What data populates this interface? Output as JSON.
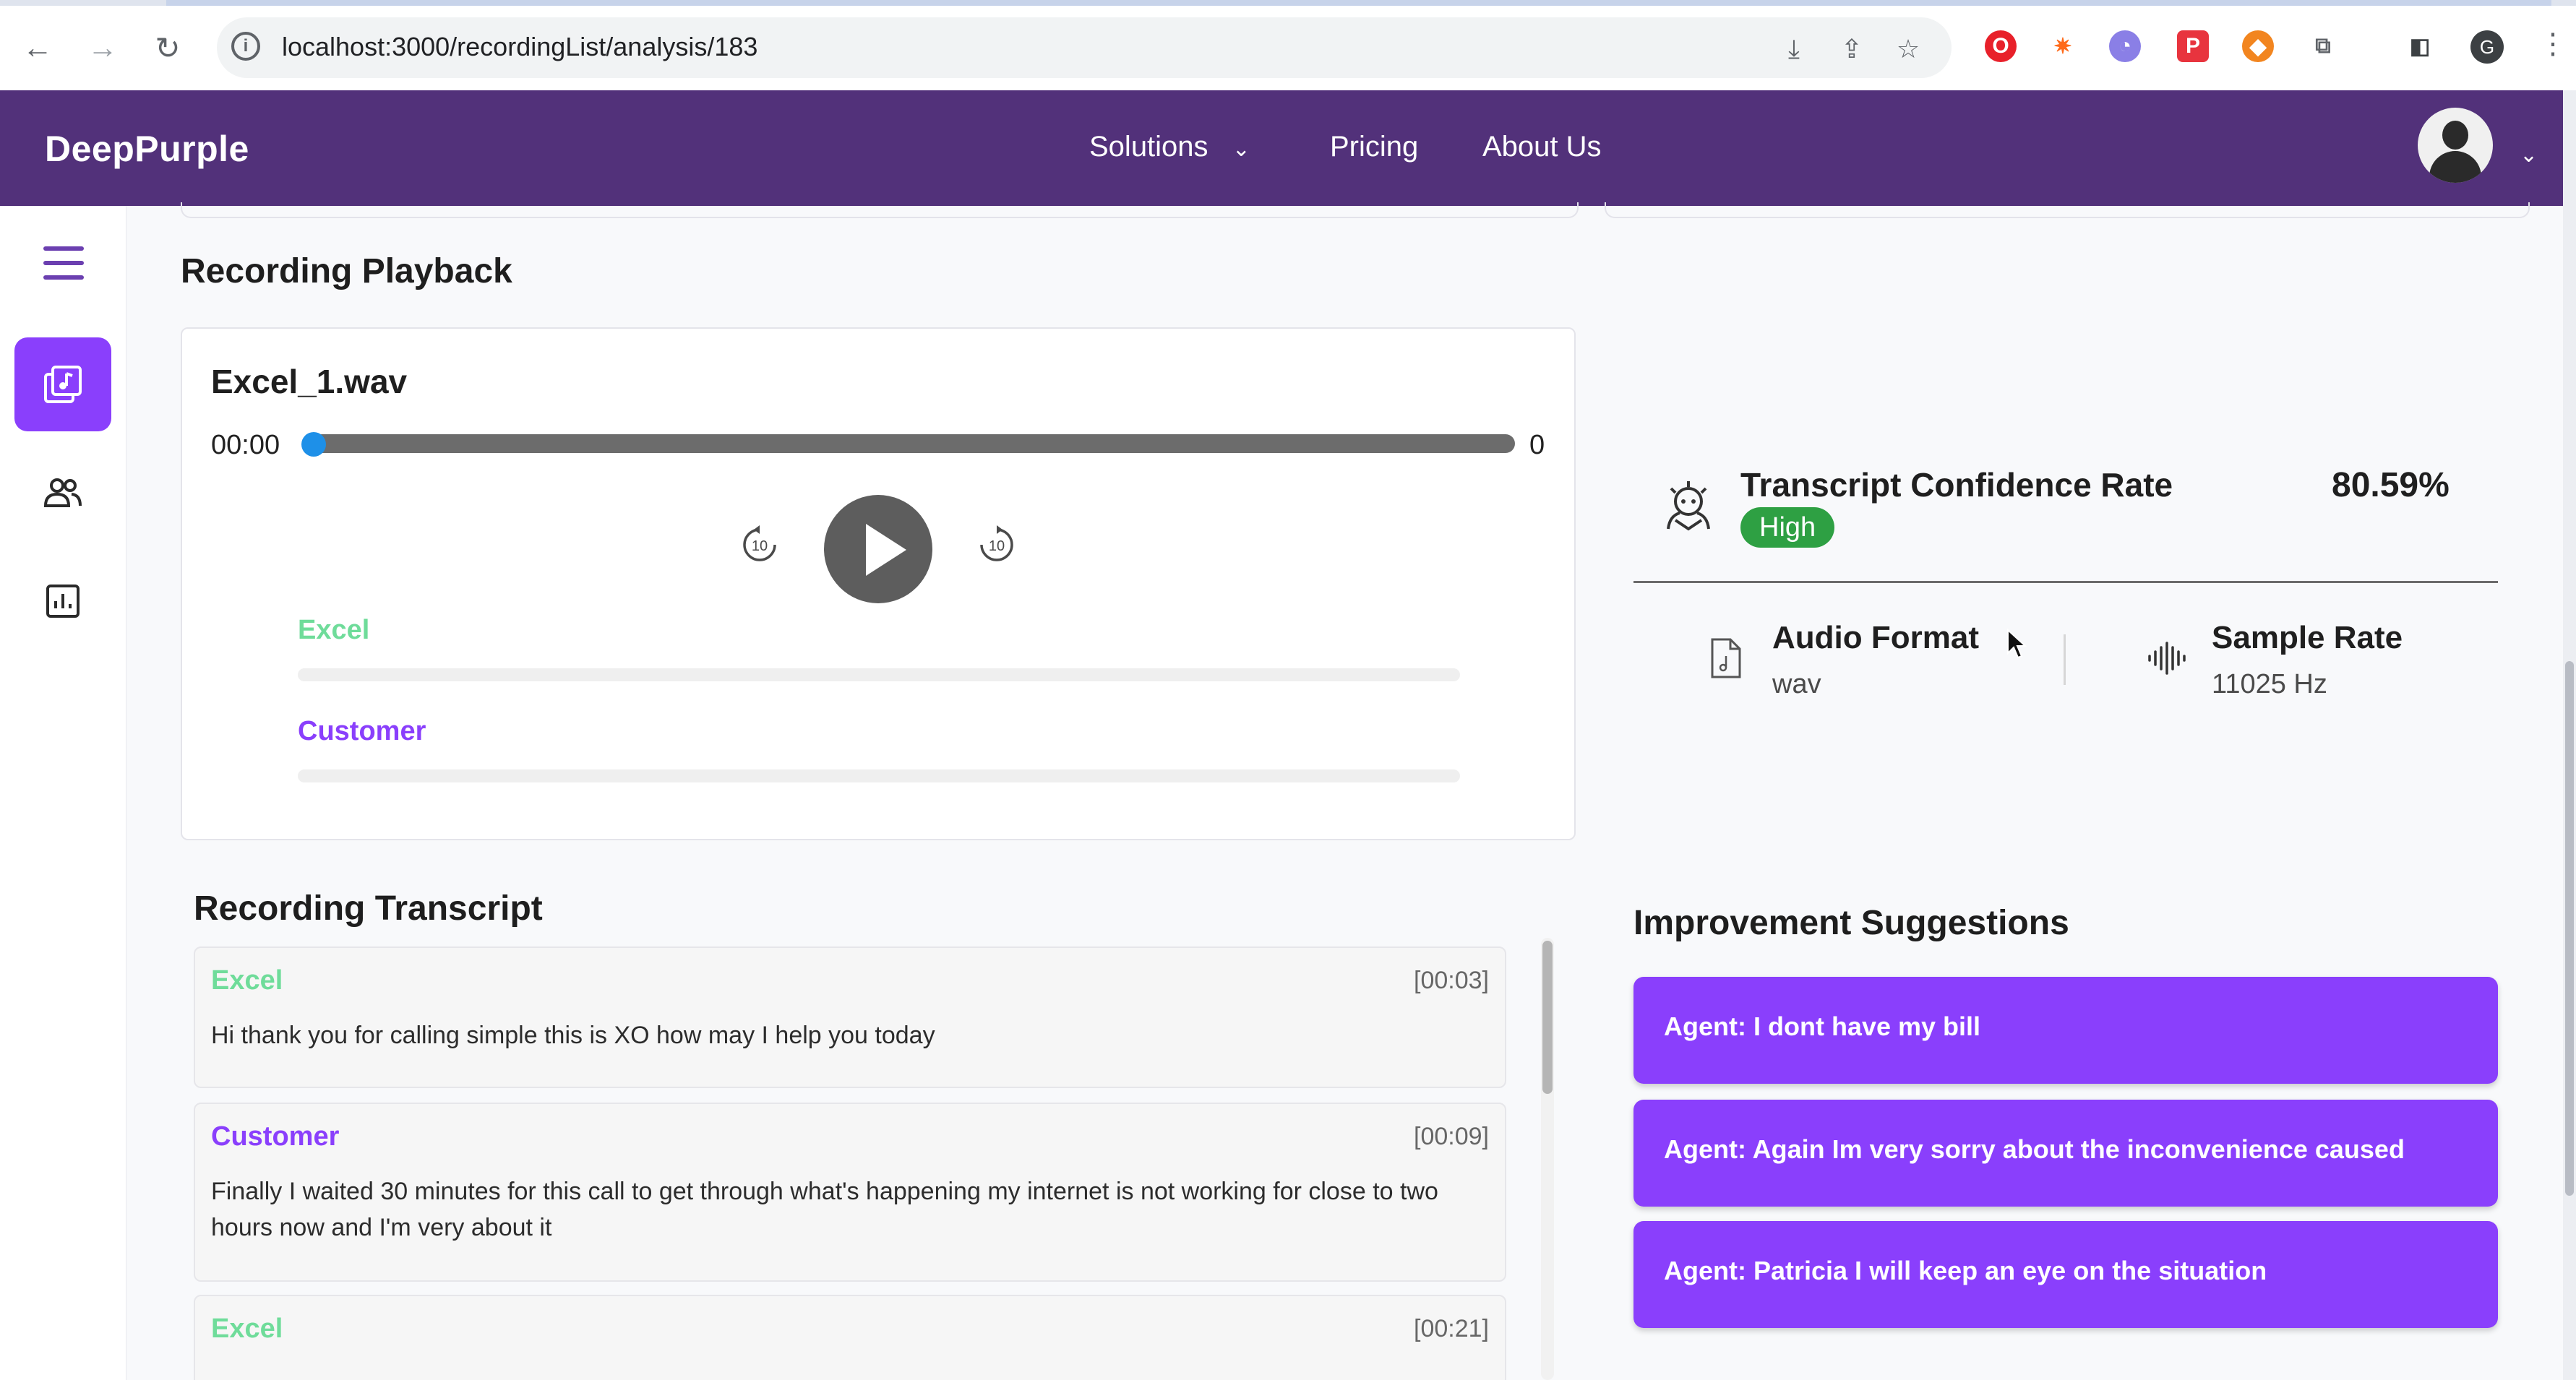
{
  "browser": {
    "url": "localhost:3000/recordingList/analysis/183",
    "profile_initial": "G"
  },
  "header": {
    "brand": "DeepPurple",
    "nav": [
      "Solutions",
      "Pricing",
      "About Us"
    ]
  },
  "sidebar": {
    "items": [
      "recordings-icon",
      "users-icon",
      "analytics-icon"
    ],
    "active_color": "#8a3ffc"
  },
  "playback": {
    "section_title": "Recording Playback",
    "file_name": "Excel_1.wav",
    "time_start": "00:00",
    "time_end": "0",
    "progress": 0,
    "skip_back": "10",
    "skip_forward": "10",
    "speakers": [
      "Excel",
      "Customer"
    ]
  },
  "transcript": {
    "section_title": "Recording Transcript",
    "entries": [
      {
        "speaker": "Excel",
        "time": "[00:03]",
        "text": "Hi thank you for calling simple this is XO how may I help you today"
      },
      {
        "speaker": "Customer",
        "time": "[00:09]",
        "text": "Finally I waited 30 minutes for this call to get through what's happening my internet is not working for close to two hours now and I'm very about it"
      },
      {
        "speaker": "Excel",
        "time": "[00:21]",
        "text": ""
      }
    ]
  },
  "confidence": {
    "title": "Transcript Confidence Rate",
    "value": "80.59%",
    "level": "High",
    "level_color": "#2ea043"
  },
  "audio": {
    "format_label": "Audio Format",
    "format_value": "wav",
    "rate_label": "Sample Rate",
    "rate_value": "11025 Hz"
  },
  "suggestions": {
    "section_title": "Improvement Suggestions",
    "items": [
      "Agent: I dont have my bill",
      "Agent: Again Im very sorry about the inconvenience caused",
      "Agent: Patricia I will keep an eye on the situation"
    ]
  },
  "colors": {
    "header_bg": "#52317a",
    "accent": "#8a3ffc",
    "excel_speaker": "#6fdc9a",
    "customer_speaker": "#8a3ffc"
  }
}
